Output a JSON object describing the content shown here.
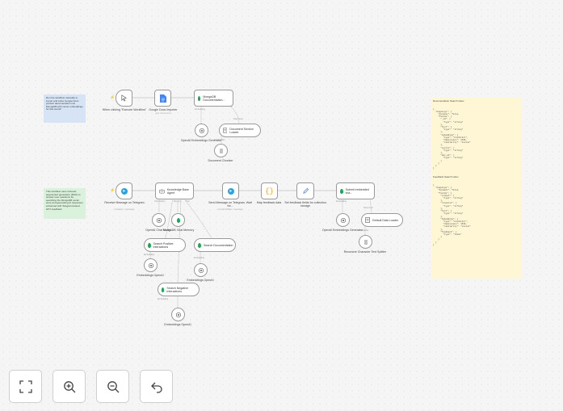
{
  "nodes": {
    "manual_trigger": {
      "label": "When clicking \"Execute Workflow\""
    },
    "google_docs": {
      "label": "Google Docs Importer",
      "sub": "get: document"
    },
    "mongo_doc": {
      "title": "MongoDB Documentation..."
    },
    "openai_emb_1": {
      "label": "OpenAI Embeddings Generator"
    },
    "doc_section_loader": {
      "title": "Document Section Loader"
    },
    "doc_chunker": {
      "label": "Document Chunker"
    },
    "telegram_trigger": {
      "label": "Receive Message on Telegram",
      "sub": "Updates: message"
    },
    "kb_agent": {
      "title": "Knowledge Base Agent"
    },
    "send_telegram": {
      "label": "Send Message on Telegram, Wait for...",
      "sub": "sendAndWait: message"
    },
    "map_feedback": {
      "label": "Map feedback data"
    },
    "set_feedback": {
      "label": "Set feedback fields for collection storage"
    },
    "submit_embedded": {
      "title": "Submit embedded cha..."
    },
    "openai_chat": {
      "label": "OpenAI Chat Model"
    },
    "mongo_memory": {
      "label": "MongoDB Chat Memory"
    },
    "search_positive": {
      "title": "Search Positive Interactions"
    },
    "search_docs": {
      "title": "Search Documentation"
    },
    "emb_openai_1": {
      "label": "Embeddings OpenAI"
    },
    "emb_openai_2": {
      "label": "Embeddings OpenAI"
    },
    "search_negative": {
      "title": "Search Negative Interactions"
    },
    "emb_openai_3": {
      "label": "Embeddings OpenAI"
    },
    "openai_emb_2": {
      "label": "OpenAI Embeddings Generator"
    },
    "default_loader": {
      "title": "Default Data Loader"
    },
    "recursive_splitter": {
      "label": "Recursive Character Text Splitter"
    }
  },
  "ports": {
    "embedding": "Embedding",
    "document": "Document",
    "text_splitter": "Text Splitter",
    "chat_model": "Chat Model",
    "memory": "Memory",
    "tool": "Tool"
  },
  "stickies": {
    "note1": "Run the workflow manually to import and index Google Docs product documentation into MongoDB with vector embeddings for fast search",
    "note2": "This workflow uses retrieval-augmented generation (RAG) to answer user questions by searching the MongoDB vector store and generating AI responses enhanced with Telegram-based HITL feedback",
    "doc_index_title": "Documentation Search index",
    "doc_index_code": "{\n  \"mappings\": {\n    \"dynamic\": false,\n    \"fields\": {\n      \"_id\": {\n        \"type\": \"string\"\n      },\n      \"text\": {\n        \"type\": \"string\"\n      },\n      \"embedding\": {\n        \"type\": \"knnVector\",\n        \"dimensions\": 1536,\n        \"similarity\": \"cosine\"\n      },\n      \"source\": {\n        \"type\": \"string\"\n      },\n      \"doc_id\": {\n        \"type\": \"string\"\n      }\n    }\n  }\n}",
    "feedback_index_title": "Feedback Search index",
    "feedback_index_code": "{\n  \"mappings\": {\n    \"dynamic\": false,\n    \"fields\": {\n      \"prompt\": {\n        \"type\": \"string\"\n      },\n      \"response\": {\n        \"type\": \"string\"\n      },\n      \"text\": {\n        \"type\": \"string\"\n      },\n      \"embedding\": {\n        \"type\": \"knnVector\",\n        \"dimensions\": 1536,\n        \"similarity\": \"cosine\"\n      },\n      \"feedback\": {\n        \"type\": \"token\"\n      }\n    }\n  }\n}"
  },
  "controls": {
    "fit_view": "fit-view-icon",
    "zoom_in": "zoom-in-icon",
    "zoom_out": "zoom-out-icon",
    "undo": "undo-icon"
  },
  "colors": {
    "mongo_green": "#13aa52",
    "telegram_blue": "#2aa3e0",
    "trigger_bolt": "#ff6d5a",
    "sticky_blue": "#d6e4f5",
    "sticky_green": "#daf1dc",
    "sticky_yellow": "#fff6d6"
  }
}
